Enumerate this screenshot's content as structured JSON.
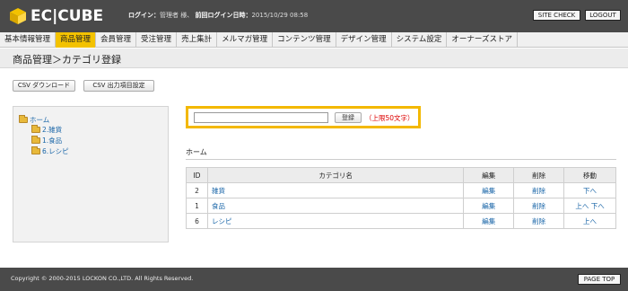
{
  "header": {
    "logo_text": "EC|CUBE",
    "login_label": "ログイン：",
    "login_user": "管理者 様、",
    "last_login_label": "前回ログイン日時：",
    "last_login_value": "2015/10/29 08:58",
    "site_check": "SITE CHECK",
    "logout": "LOGOUT"
  },
  "nav": {
    "items": [
      {
        "label": "基本情報管理"
      },
      {
        "label": "商品管理"
      },
      {
        "label": "会員管理"
      },
      {
        "label": "受注管理"
      },
      {
        "label": "売上集計"
      },
      {
        "label": "メルマガ管理"
      },
      {
        "label": "コンテンツ管理"
      },
      {
        "label": "デザイン管理"
      },
      {
        "label": "システム設定"
      },
      {
        "label": "オーナーズストア"
      }
    ],
    "active_index": 1,
    "active_color": "#f3c200"
  },
  "page": {
    "title": "商品管理＞カテゴリ登録"
  },
  "buttons": {
    "csv_download": "CSV ダウンロード",
    "csv_settings": "CSV 出力項目設定"
  },
  "tree": {
    "root": "ホーム",
    "children": [
      "2.雑貨",
      "1.食品",
      "6.レシピ"
    ]
  },
  "form": {
    "input_value": "",
    "register": "登録",
    "limit_note": "（上限50文字）"
  },
  "section": {
    "heading": "ホーム"
  },
  "table": {
    "headers": [
      "ID",
      "カテゴリ名",
      "編集",
      "削除",
      "移動"
    ],
    "rows": [
      {
        "id": "2",
        "name": "雑貨",
        "edit": "編集",
        "delete": "削除",
        "move": "下へ"
      },
      {
        "id": "1",
        "name": "食品",
        "edit": "編集",
        "delete": "削除",
        "move": "上へ 下へ"
      },
      {
        "id": "6",
        "name": "レシピ",
        "edit": "編集",
        "delete": "削除",
        "move": "上へ"
      }
    ]
  },
  "footer": {
    "copyright": "Copyright © 2000-2015 LOCKON CO.,LTD. All Rights Reserved.",
    "page_top": "PAGE TOP"
  },
  "colors": {
    "header_bg": "#4a4a4a",
    "accent": "#f3c200",
    "link": "#1a66a8",
    "note": "#dd0000"
  }
}
